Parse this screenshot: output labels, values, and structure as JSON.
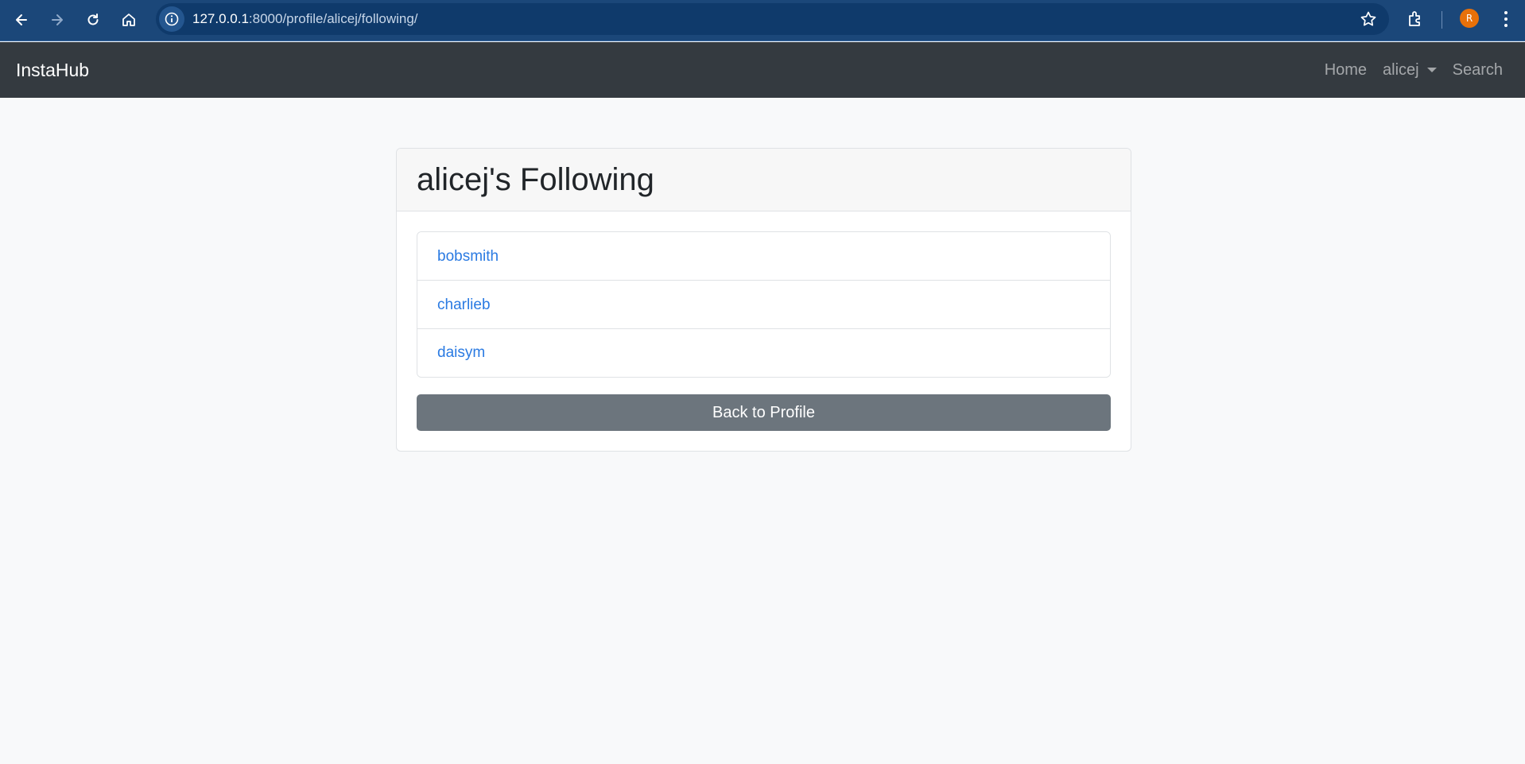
{
  "browser": {
    "url_host": "127.0.0.1",
    "url_rest": ":8000/profile/alicej/following/",
    "profile_initial": "R",
    "icons": [
      "back-arrow-icon",
      "forward-arrow-icon",
      "reload-icon",
      "home-icon",
      "info-icon",
      "star-icon",
      "extensions-icon",
      "kebab-menu-icon"
    ]
  },
  "navbar": {
    "brand": "InstaHub",
    "links": {
      "home": "Home",
      "user": "alicej",
      "search": "Search"
    }
  },
  "card": {
    "title": "alicej's Following",
    "following": [
      "bobsmith",
      "charlieb",
      "daisym"
    ],
    "back_button": "Back to Profile"
  },
  "colors": {
    "browser_bar": "#1b4779",
    "navbar": "#343a40",
    "link": "#2a7ae2",
    "secondary_button": "#6c757d",
    "page_background": "#f8f9fa"
  }
}
